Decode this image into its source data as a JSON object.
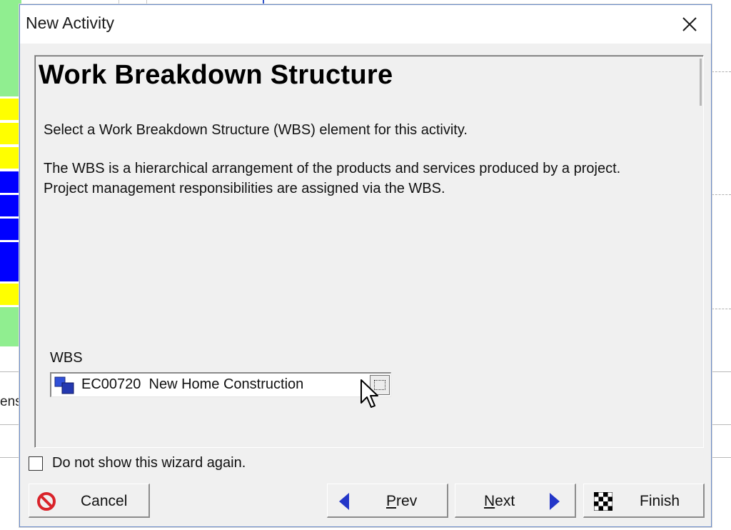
{
  "dialog": {
    "title": "New Activity",
    "heading": "Work Breakdown Structure",
    "paragraph1": "Select a Work Breakdown Structure (WBS) element for this activity.",
    "paragraph2_line1": "The WBS is a hierarchical arrangement of the products and services produced by a project.",
    "paragraph2_line2": "Project management responsibilities are assigned via the WBS."
  },
  "wbs": {
    "label": "WBS",
    "value": "EC00720  New Home Construction",
    "icon": "wbs-node-icon"
  },
  "checkbox": {
    "label": "Do not show this wizard again.",
    "checked": false
  },
  "buttons": {
    "cancel": "Cancel",
    "prev_first": "P",
    "prev_rest": "rev",
    "next_first": "N",
    "next_rest": "ext",
    "finish": "Finish"
  },
  "background": {
    "partial_text": "ens"
  },
  "colors": {
    "bar_green": "#90ee90",
    "bar_yellow": "#ffff00",
    "bar_blue": "#0000ff",
    "cancel_red": "#d9232a",
    "arrow_blue": "#2336c8",
    "dialog_border": "#6a8cc9"
  }
}
